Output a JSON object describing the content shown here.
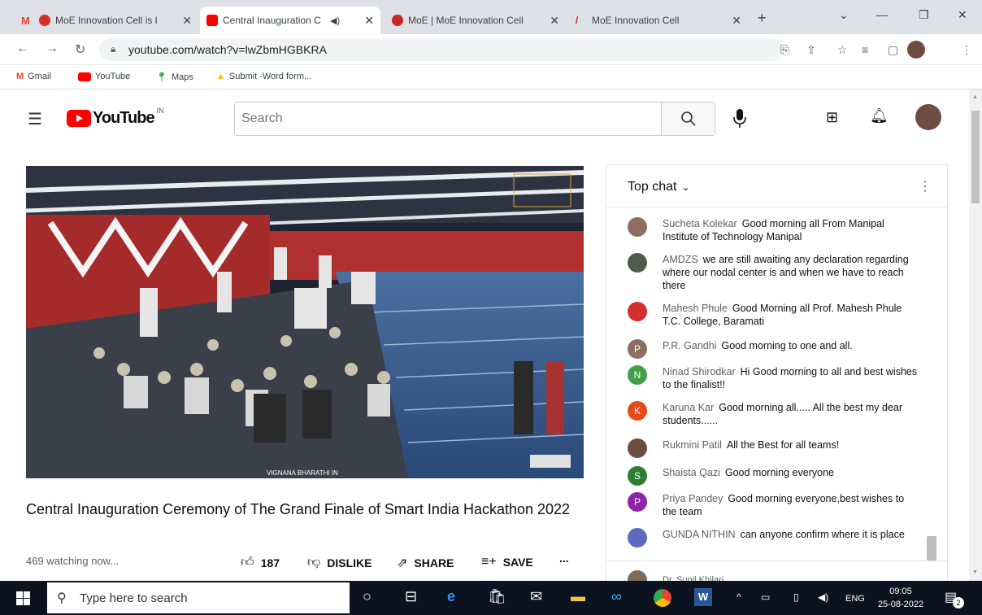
{
  "browser": {
    "tabs": [
      {
        "label": "MoE Innovation Cell is l",
        "close": "✕"
      },
      {
        "label": "Central Inauguration C",
        "close": "✕"
      },
      {
        "label": "MoE | MoE Innovation Cell",
        "close": "✕"
      },
      {
        "label": "MoE Innovation Cell",
        "close": "✕"
      }
    ],
    "new_tab": "+",
    "url": "youtube.com/watch?v=lwZbmHGBKRA",
    "bookmarks": [
      {
        "label": "Gmail",
        "icon": "gmail-icon"
      },
      {
        "label": "YouTube",
        "icon": "youtube-icon"
      },
      {
        "label": "Maps",
        "icon": "maps-icon"
      },
      {
        "label": "Submit -Word form...",
        "icon": "drive-icon"
      }
    ]
  },
  "youtube": {
    "logo_text": "YouTube",
    "logo_region": "IN",
    "search_placeholder": "Search",
    "video": {
      "title": "Central Inauguration Ceremony of The Grand Finale of Smart India Hackathon 2022",
      "watching": "469 watching now...",
      "likes": "187",
      "dislike_label": "DISLIKE",
      "share_label": "SHARE",
      "save_label": "SAVE",
      "more": "...",
      "watermark": "VIGNANA BHARATHI IN"
    },
    "chat": {
      "header": "Top chat",
      "messages": [
        {
          "author": "Sucheta Kolekar",
          "text": "Good morning all From Manipal Institute of Technology Manipal",
          "avatar": "",
          "color": "#8d6e63"
        },
        {
          "author": "AMDZS",
          "text": "we are still awaiting any declaration regarding where our nodal center is and when we have to reach there",
          "avatar": "",
          "color": "#4e5d4a"
        },
        {
          "author": "Mahesh Phule",
          "text": "Good Morning all Prof. Mahesh Phule T.C. College, Baramati",
          "avatar": "",
          "color": "#d32f2f"
        },
        {
          "author": "P.R. Gandhi",
          "text": "Good morning to one and all.",
          "avatar": "P",
          "color": "#8d6e63"
        },
        {
          "author": "Ninad Shirodkar",
          "text": "Hi Good morning to all and best wishes to the finalist!!",
          "avatar": "N",
          "color": "#43a047"
        },
        {
          "author": "Karuna Kar",
          "text": "Good morning all..... All the best my dear students......",
          "avatar": "K",
          "color": "#e64a19"
        },
        {
          "author": "Rukmini Patil",
          "text": "All the Best for all teams!",
          "avatar": "",
          "color": "#6d4c41"
        },
        {
          "author": "Shaista Qazi",
          "text": "Good morning everyone",
          "avatar": "S",
          "color": "#2e7d32"
        },
        {
          "author": "Priya Pandey",
          "text": "Good morning everyone,best wishes to the team",
          "avatar": "P",
          "color": "#8e24aa"
        },
        {
          "author": "GUNDA NITHIN",
          "text": "can anyone confirm where it is place",
          "avatar": "",
          "color": "#5c6bc0"
        }
      ],
      "partial_author": "Dr. Sunil Khilari"
    }
  },
  "taskbar": {
    "search_placeholder": "Type here to search",
    "lang": "ENG",
    "time": "09:05",
    "date": "25-08-2022",
    "notifications": "2"
  }
}
